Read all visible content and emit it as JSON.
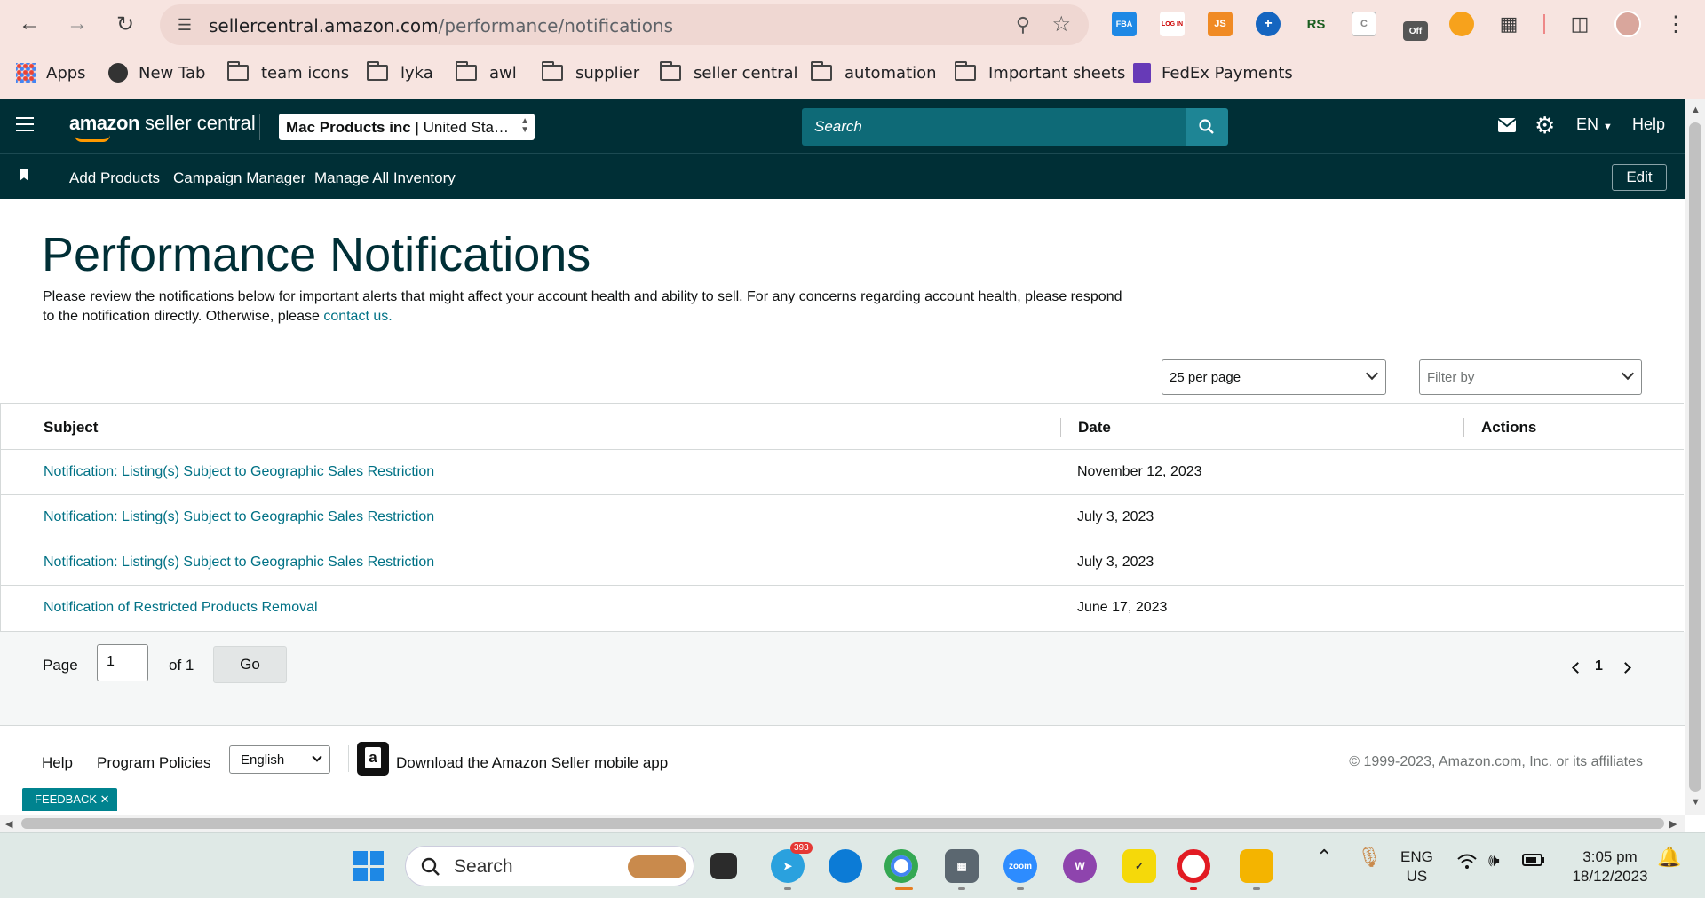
{
  "browser": {
    "url_host": "sellercentral.amazon.com",
    "url_path": "/performance/notifications",
    "bookmarks": [
      "Apps",
      "New Tab",
      "team icons",
      "lyka",
      "awl",
      "supplier",
      "seller central",
      "automation",
      "Important sheets",
      "FedEx Payments"
    ],
    "extensions": [
      "FBA",
      "LOG IN",
      "JS",
      "+",
      "RS",
      "C",
      "Off"
    ]
  },
  "header": {
    "logo_bold": "amazon",
    "logo_light": " seller central",
    "account_name": "Mac Products inc",
    "account_region": " | United Sta…",
    "search_placeholder": "Search",
    "language": "EN",
    "help": "Help"
  },
  "subnav": {
    "links": [
      "Add Products",
      "Campaign Manager",
      "Manage All Inventory"
    ],
    "edit": "Edit"
  },
  "page": {
    "title": "Performance Notifications",
    "intro_text": "Please review the notifications below for important alerts that might affect your account health and ability to sell. For any concerns regarding account health, please respond to the notification directly. Otherwise, please ",
    "intro_link": "contact us.",
    "per_page": "25 per page",
    "filter_placeholder": "Filter by"
  },
  "table": {
    "columns": [
      "Subject",
      "Date",
      "Actions"
    ],
    "rows": [
      {
        "subject": "Notification: Listing(s) Subject to Geographic Sales Restriction",
        "date": "November 12, 2023"
      },
      {
        "subject": "Notification: Listing(s) Subject to Geographic Sales Restriction",
        "date": "July 3, 2023"
      },
      {
        "subject": "Notification: Listing(s) Subject to Geographic Sales Restriction",
        "date": "July 3, 2023"
      },
      {
        "subject": "Notification of Restricted Products Removal",
        "date": "June 17, 2023"
      }
    ]
  },
  "pager": {
    "page_label": "Page",
    "page_value": "1",
    "of_label": "of 1",
    "go": "Go",
    "current": "1"
  },
  "footer": {
    "help": "Help",
    "policies": "Program Policies",
    "language": "English",
    "app_text": "Download the Amazon Seller mobile app",
    "copyright": "© 1999-2023, Amazon.com, Inc. or its affiliates",
    "feedback": "FEEDBACK ✕"
  },
  "taskbar": {
    "search": "Search",
    "telegram_badge": "393",
    "zoom_label": "zoom",
    "lang_top": "ENG",
    "lang_bottom": "US",
    "time": "3:05 pm",
    "date": "18/12/2023"
  },
  "colors": {
    "header_bg": "#002f36",
    "search_bg": "#0e6a77",
    "link": "#007185",
    "chrome_bg": "#f7e4e0",
    "feedback_bg": "#00838f"
  }
}
